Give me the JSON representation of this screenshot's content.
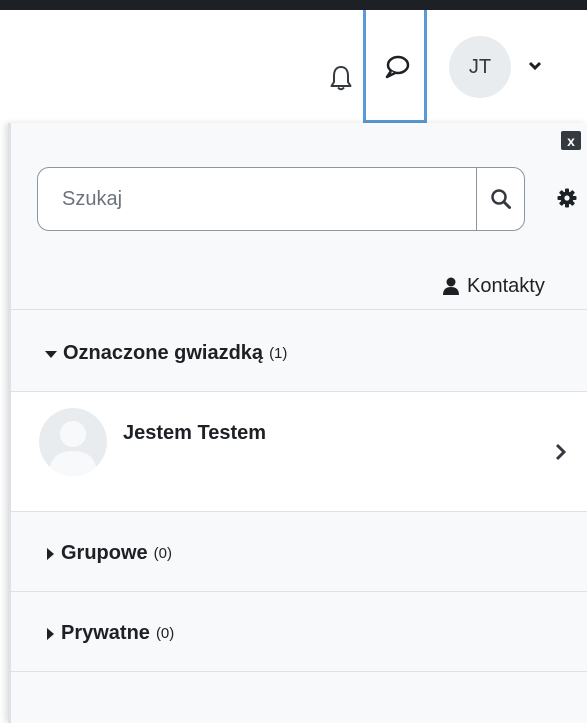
{
  "navbar": {
    "user_initials": "JT",
    "icons": {
      "notifications": "bell-icon",
      "messages": "speech-bubble-icon",
      "user_menu": "chevron-down-icon"
    }
  },
  "drawer": {
    "close_label": "x",
    "search": {
      "placeholder": "Szukaj",
      "value": "",
      "button_icon": "search-icon"
    },
    "settings_icon": "gear-icon",
    "contacts_link": {
      "label": "Kontakty",
      "icon": "user-icon"
    },
    "sections": [
      {
        "title": "Oznaczone gwiazdką",
        "count": "(1)",
        "expanded": true,
        "items": [
          {
            "name": "Jestem Testem",
            "avatar": "default-user-avatar"
          }
        ]
      },
      {
        "title": "Grupowe",
        "count": "(0)",
        "expanded": false
      },
      {
        "title": "Prywatne",
        "count": "(0)",
        "expanded": false
      }
    ]
  },
  "colors": {
    "drawer_bg": "#f8f9fa",
    "focus_outline": "#5b9bd5",
    "text": "#1d2125"
  }
}
